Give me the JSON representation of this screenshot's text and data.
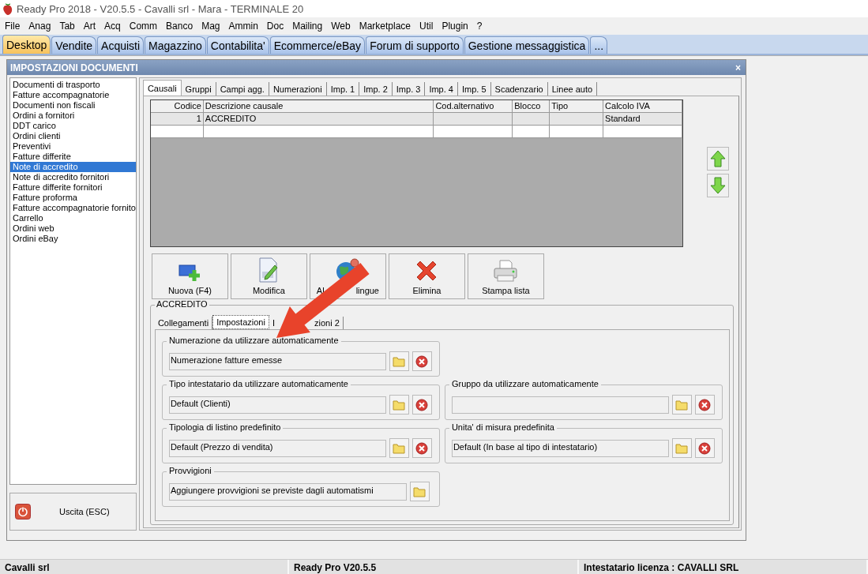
{
  "window": {
    "title": "Ready Pro 2018 - V20.5.5 - Cavalli srl - Mara - TERMINALE 20"
  },
  "menu": [
    "File",
    "Anag",
    "Tab",
    "Art",
    "Acq",
    "Comm",
    "Banco",
    "Mag",
    "Ammin",
    "Doc",
    "Mailing",
    "Web",
    "Marketplace",
    "Util",
    "Plugin",
    "?"
  ],
  "tabs": [
    {
      "label": "Desktop",
      "selected": true
    },
    {
      "label": "Vendite",
      "selected": false
    },
    {
      "label": "Acquisti",
      "selected": false
    },
    {
      "label": "Magazzino",
      "selected": false
    },
    {
      "label": "Contabilita'",
      "selected": false
    },
    {
      "label": "Ecommerce/eBay",
      "selected": false
    },
    {
      "label": "Forum di supporto",
      "selected": false
    },
    {
      "label": "Gestione messaggistica",
      "selected": false
    },
    {
      "label": "...",
      "selected": false
    }
  ],
  "dialog": {
    "title": "IMPOSTAZIONI DOCUMENTI",
    "close": "×",
    "documents": [
      {
        "label": "Documenti di trasporto",
        "selected": false
      },
      {
        "label": "Fatture accompagnatorie",
        "selected": false
      },
      {
        "label": "Documenti non fiscali",
        "selected": false
      },
      {
        "label": "Ordini a fornitori",
        "selected": false
      },
      {
        "label": "DDT carico",
        "selected": false
      },
      {
        "label": "Ordini clienti",
        "selected": false
      },
      {
        "label": "Preventivi",
        "selected": false
      },
      {
        "label": "Fatture differite",
        "selected": false
      },
      {
        "label": "Note di accredito",
        "selected": true
      },
      {
        "label": "Note di accredito fornitori",
        "selected": false
      },
      {
        "label": "Fatture differite fornitori",
        "selected": false
      },
      {
        "label": "Fatture proforma",
        "selected": false
      },
      {
        "label": "Fatture accompagnatorie fornito",
        "selected": false
      },
      {
        "label": "Carrello",
        "selected": false
      },
      {
        "label": "Ordini web",
        "selected": false
      },
      {
        "label": "Ordini eBay",
        "selected": false
      }
    ],
    "exit_button": "Uscita (ESC)",
    "tabs": [
      {
        "label": "Causali",
        "selected": true
      },
      {
        "label": "Gruppi",
        "selected": false
      },
      {
        "label": "Campi agg.",
        "selected": false
      },
      {
        "label": "Numerazioni",
        "selected": false
      },
      {
        "label": "Imp. 1",
        "selected": false
      },
      {
        "label": "Imp. 2",
        "selected": false
      },
      {
        "label": "Imp. 3",
        "selected": false
      },
      {
        "label": "Imp. 4",
        "selected": false
      },
      {
        "label": "Imp. 5",
        "selected": false
      },
      {
        "label": "Scadenzario",
        "selected": false
      },
      {
        "label": "Linee auto",
        "selected": false
      }
    ],
    "table": {
      "columns": [
        "Codice",
        "Descrizione causale",
        "Cod.alternativo",
        "Blocco",
        "Tipo",
        "Calcolo IVA"
      ],
      "rows": [
        {
          "cells": [
            "1",
            "ACCREDITO",
            "",
            "",
            "",
            "Standard"
          ],
          "selected": true
        }
      ]
    },
    "actions": [
      {
        "kind": "new",
        "label_parts": [
          "Nuova (F4)"
        ]
      },
      {
        "kind": "edit",
        "label_parts": [
          "Modifica"
        ]
      },
      {
        "kind": "languages",
        "label_parts": [
          "Al",
          "lingue"
        ]
      },
      {
        "kind": "delete",
        "label_parts": [
          "Elimina"
        ]
      },
      {
        "kind": "print",
        "label_parts": [
          "Stampa lista"
        ]
      }
    ],
    "group_title": "ACCREDITO",
    "subtabs": [
      {
        "label_parts": [
          "Collegamenti"
        ],
        "selected": false
      },
      {
        "label_parts": [
          "Impostazioni"
        ],
        "selected": true
      },
      {
        "label_parts": [
          "I",
          "zioni 2"
        ],
        "selected": false
      }
    ],
    "field_rows": [
      [
        {
          "label": "Numerazione da utilizzare automaticamente",
          "value": "Numerazione fatture emesse",
          "clearable": true
        }
      ],
      [
        {
          "label": "Tipo intestatario da utilizzare automaticamente",
          "value": "Default (Clienti)",
          "clearable": true
        },
        {
          "label": "Gruppo da utilizzare automaticamente",
          "clearable": true
        }
      ],
      [
        {
          "label": "Tipologia di listino predefinito",
          "value": "Default (Prezzo di vendita)",
          "clearable": true
        },
        {
          "label": "Unita' di misura predefinita",
          "value": "Default (In base al tipo di intestatario)",
          "clearable": true
        }
      ],
      [
        {
          "label": "Provvigioni",
          "value": "Aggiungere provvigioni se previste dagli automatismi",
          "clearable": false,
          "wide": true
        }
      ]
    ]
  },
  "overlay": {
    "kind": "arrow"
  },
  "status_bar": [
    "Cavalli srl",
    "Ready Pro V20.5.5",
    "Intestatario licenza : CAVALLI SRL"
  ]
}
